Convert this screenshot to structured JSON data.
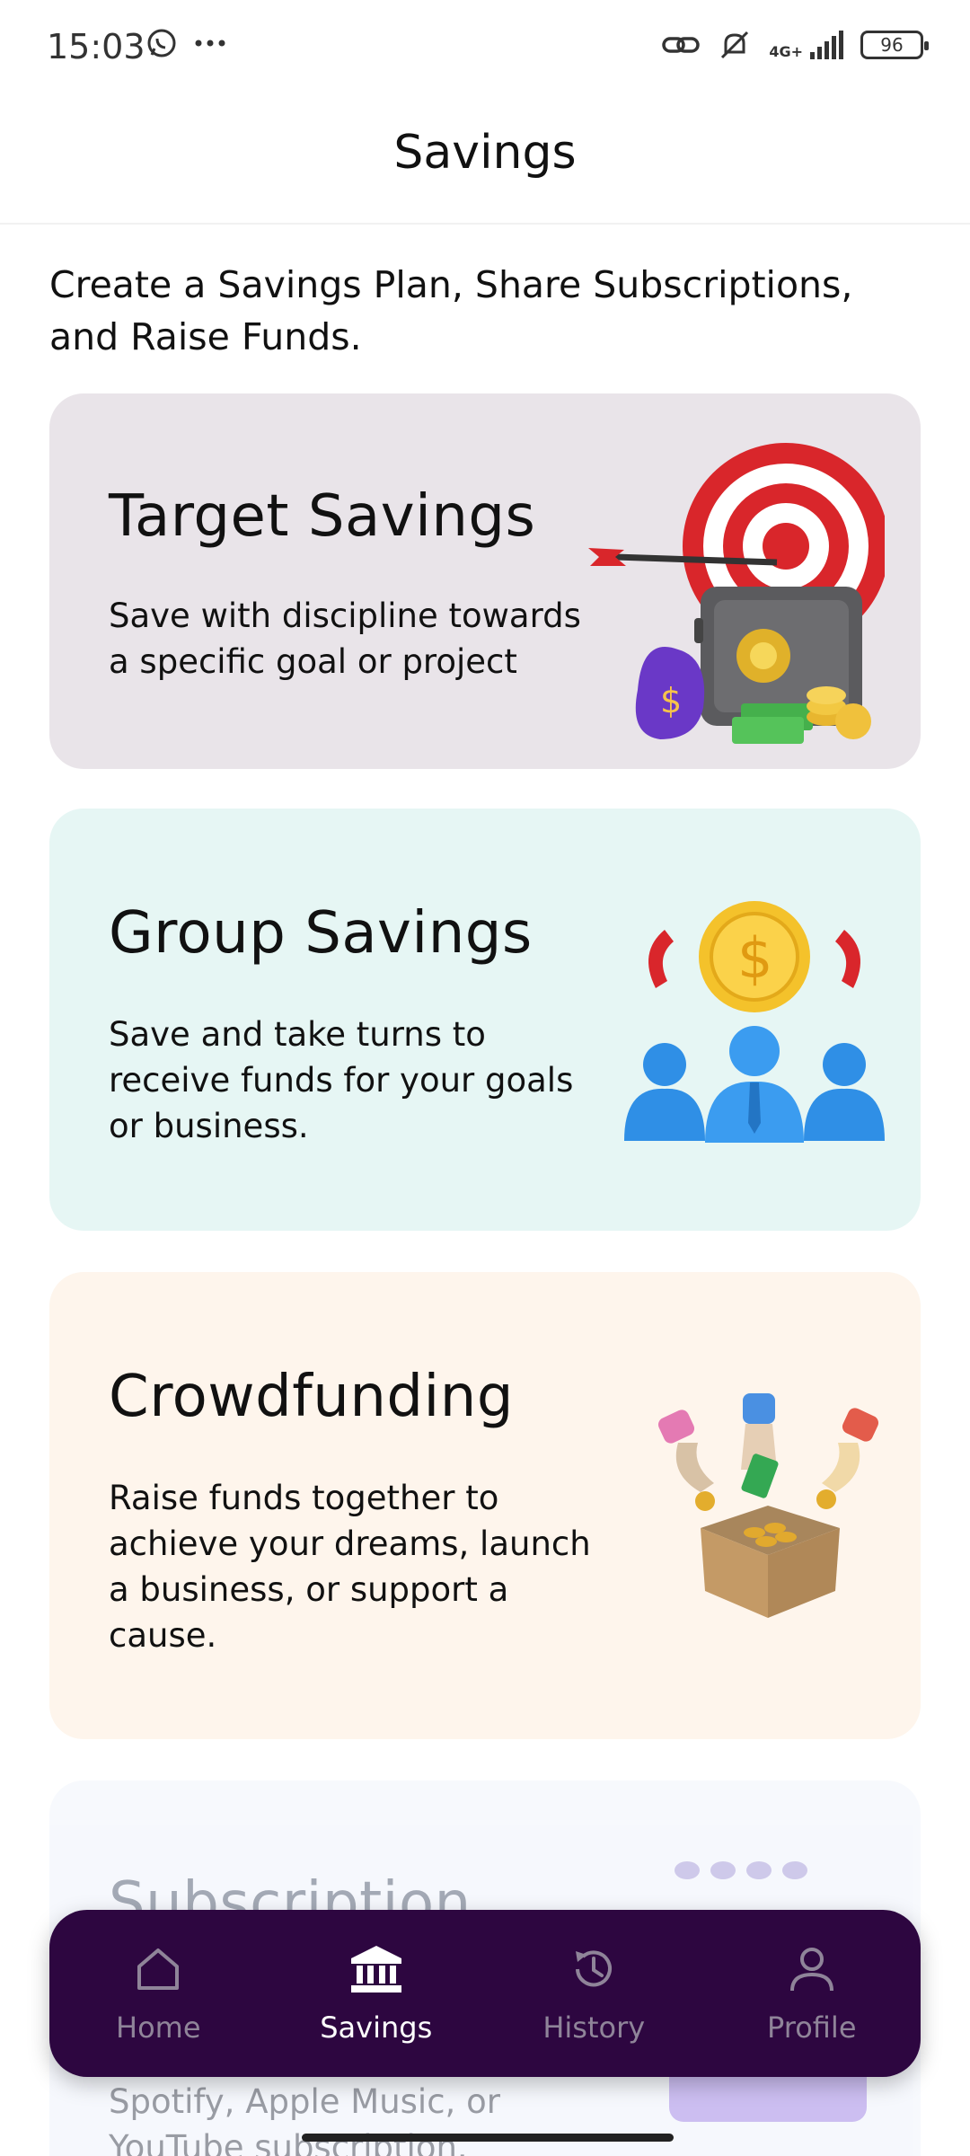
{
  "status_bar": {
    "time": "15:03",
    "battery": "96",
    "network": "4G+",
    "icons": [
      "whatsapp-icon",
      "more-dots-icon",
      "link-icon",
      "mute-icon",
      "signal-icon",
      "battery-icon"
    ]
  },
  "header": {
    "title": "Savings"
  },
  "intro": "Create a Savings Plan, Share Subscriptions, and Raise Funds.",
  "cards": [
    {
      "title": "Target Savings",
      "description": "Save with discipline towards a specific goal or project",
      "art": "target-safe-illustration",
      "background": "#e9e4e9"
    },
    {
      "title": "Group Savings",
      "description": "Save and take turns to receive funds for your goals or business.",
      "art": "group-coin-illustration",
      "background": "#e6f6f4"
    },
    {
      "title": "Crowdfunding",
      "description": "Raise funds together to achieve your dreams, launch a business, or support a cause.",
      "art": "crowdfunding-box-illustration",
      "background": "#fef5ec"
    },
    {
      "title": "Subscription",
      "description": "Spotify, Apple Music, or YouTube subscription.",
      "art": "subscription-illustration",
      "background": "#f6f8fd"
    }
  ],
  "bottom_nav": {
    "background": "#2d0640",
    "items": [
      {
        "label": "Home",
        "icon": "home-icon",
        "active": false
      },
      {
        "label": "Savings",
        "icon": "bank-icon",
        "active": true
      },
      {
        "label": "History",
        "icon": "history-icon",
        "active": false
      },
      {
        "label": "Profile",
        "icon": "profile-icon",
        "active": false
      }
    ]
  }
}
